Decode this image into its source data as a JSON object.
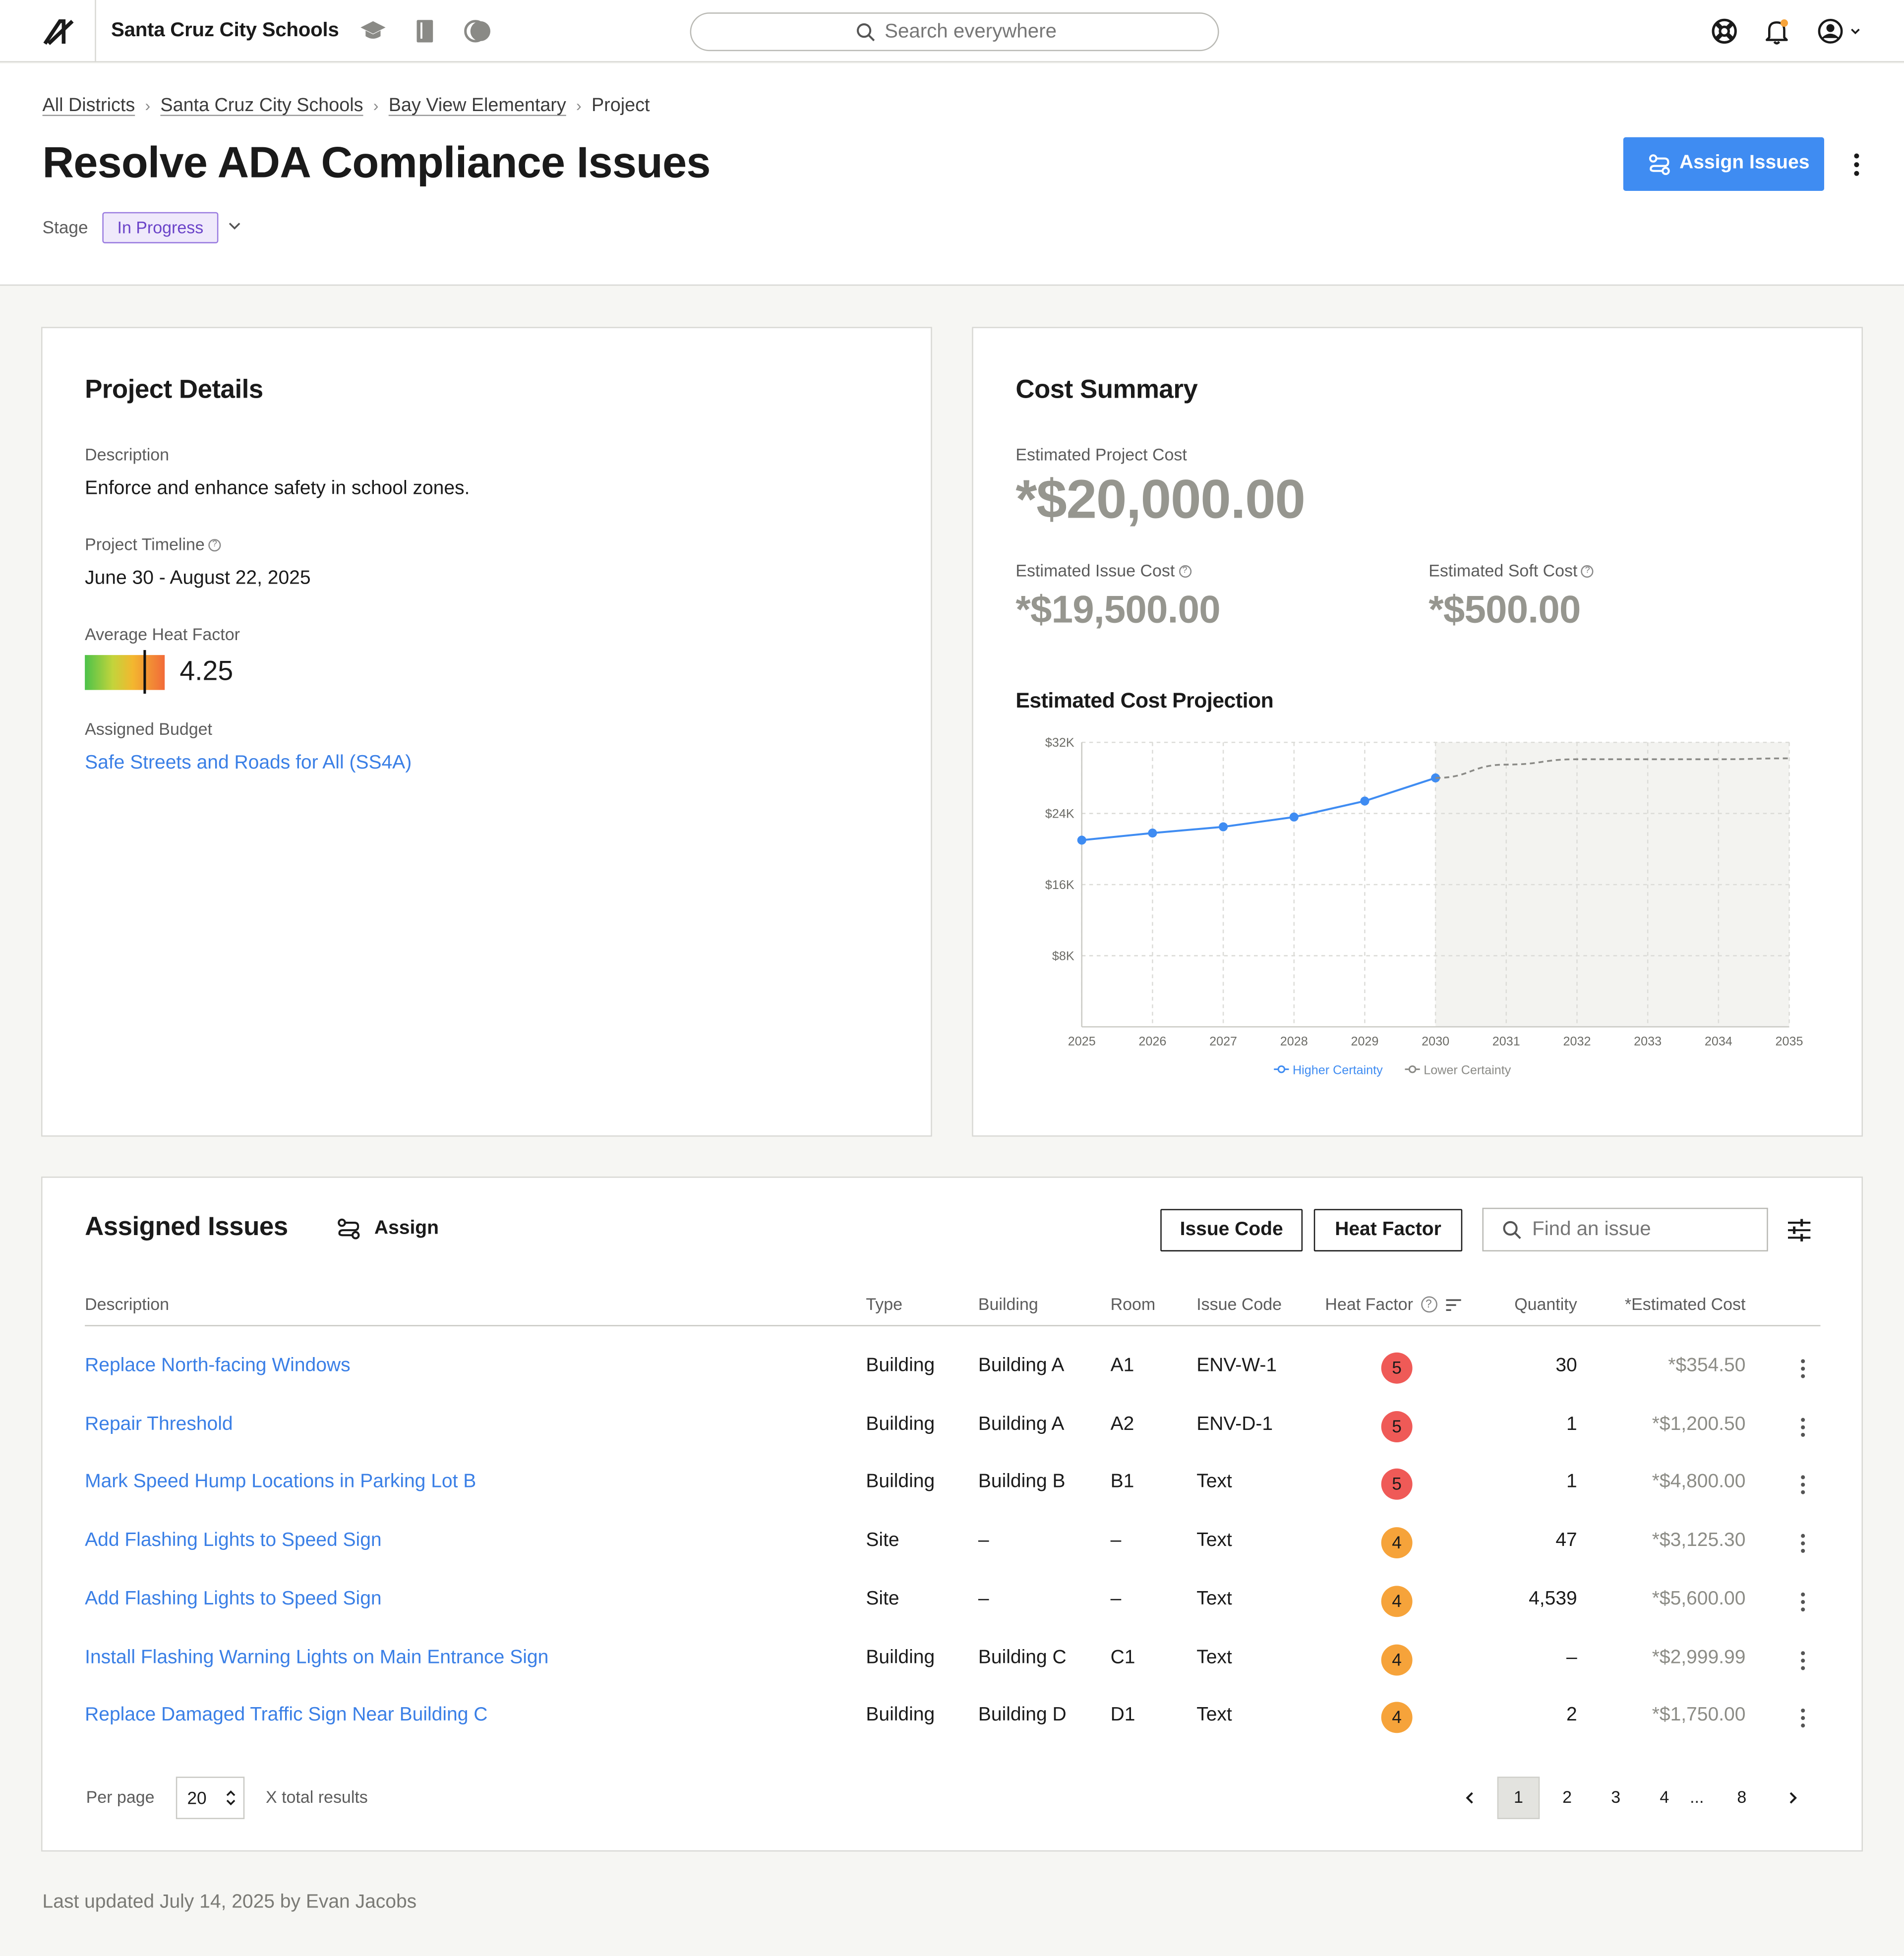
{
  "topbar": {
    "org_name": "Santa Cruz City Schools",
    "icons": [
      "logo-icon",
      "graduation-cap-icon",
      "book-icon",
      "toggle-icon"
    ],
    "search_placeholder": "Search everywhere",
    "right_icons": [
      "help-lifebuoy-icon",
      "notification-bell-icon",
      "user-account-icon"
    ],
    "accent": "#f6a33a"
  },
  "header": {
    "breadcrumbs": [
      "All Districts",
      "Santa Cruz City Schools",
      "Bay View Elementary",
      "Project"
    ],
    "title": "Resolve ADA Compliance Issues",
    "stage_label": "Stage",
    "stage_value": "In Progress",
    "assign_button": "Assign Issues"
  },
  "details": {
    "title": "Project Details",
    "description_label": "Description",
    "description": "Enforce and enhance safety in school zones.",
    "timeline_label": "Project Timeline",
    "timeline": "June 30 - August 22, 2025",
    "heat_label": "Average Heat Factor",
    "heat_value": "4.25",
    "heat_value_fraction": 0.75,
    "budget_label": "Assigned Budget",
    "budget": "Safe Streets and Roads for All (SS4A)"
  },
  "cost": {
    "title": "Cost Summary",
    "project_label": "Estimated Project Cost",
    "project_value": "*$20,000.00",
    "issue_label": "Estimated Issue Cost",
    "issue_value": "*$19,500.00",
    "soft_label": "Estimated Soft Cost",
    "soft_value": "*$500.00",
    "projection_title": "Estimated Cost Projection"
  },
  "chart_data": {
    "type": "line",
    "title": "Estimated Cost Projection",
    "x": [
      "2025",
      "2026",
      "2027",
      "2028",
      "2029",
      "2030",
      "2031",
      "2032",
      "2033",
      "2034",
      "2035"
    ],
    "y_ticks": [
      "$32K",
      "$24K",
      "$16K",
      "$8K"
    ],
    "ylim": [
      0,
      32000
    ],
    "grid": true,
    "legend_position": "bottom-center",
    "series": [
      {
        "name": "Higher Certainty",
        "color": "#3f8cf2",
        "style": "solid",
        "x": [
          2025,
          2026,
          2027,
          2028,
          2029,
          2030
        ],
        "values": [
          21000,
          21800,
          22500,
          23600,
          25400,
          28000
        ]
      },
      {
        "name": "Lower Certainty",
        "color": "#8a8a86",
        "style": "dashed",
        "x": [
          2030,
          2031,
          2032,
          2033,
          2034,
          2035
        ],
        "values": [
          28000,
          29500,
          30100,
          30100,
          30100,
          30200
        ]
      }
    ]
  },
  "issues": {
    "title": "Assigned Issues",
    "assign_label": "Assign",
    "filter_issue_code": "Issue Code",
    "filter_heat_factor": "Heat Factor",
    "find_placeholder": "Find an issue",
    "columns": [
      "Description",
      "Type",
      "Building",
      "Room",
      "Issue Code",
      "Heat Factor",
      "Quantity",
      "*Estimated Cost"
    ],
    "rows": [
      {
        "description": "Replace North-facing Windows",
        "type": "Building",
        "building": "Building A",
        "room": "A1",
        "code": "ENV-W-1",
        "heat": "5",
        "quantity": "30",
        "cost": "*$354.50"
      },
      {
        "description": "Repair Threshold",
        "type": "Building",
        "building": "Building A",
        "room": "A2",
        "code": "ENV-D-1",
        "heat": "5",
        "quantity": "1",
        "cost": "*$1,200.50"
      },
      {
        "description": "Mark Speed Hump Locations in Parking Lot B",
        "type": "Building",
        "building": "Building B",
        "room": "B1",
        "code": "Text",
        "heat": "5",
        "quantity": "1",
        "cost": "*$4,800.00"
      },
      {
        "description": "Add Flashing Lights to Speed Sign",
        "type": "Site",
        "building": "–",
        "room": "–",
        "code": "Text",
        "heat": "4",
        "quantity": "47",
        "cost": "*$3,125.30"
      },
      {
        "description": "Add Flashing Lights to Speed Sign",
        "type": "Site",
        "building": "–",
        "room": "–",
        "code": "Text",
        "heat": "4",
        "quantity": "4,539",
        "cost": "*$5,600.00"
      },
      {
        "description": "Install Flashing Warning Lights on Main Entrance Sign",
        "type": "Building",
        "building": "Building C",
        "room": "C1",
        "code": "Text",
        "heat": "4",
        "quantity": "–",
        "cost": "*$2,999.99"
      },
      {
        "description": "Replace Damaged Traffic Sign Near Building C",
        "type": "Building",
        "building": "Building D",
        "room": "D1",
        "code": "Text",
        "heat": "4",
        "quantity": "2",
        "cost": "*$1,750.00"
      }
    ],
    "per_page_label": "Per page",
    "per_page": "20",
    "total_results": "X total results",
    "pages": [
      "1",
      "2",
      "3",
      "4",
      "...",
      "8"
    ],
    "current_page": "1"
  },
  "footer": {
    "text": "Last updated July 14, 2025 by Evan Jacobs"
  }
}
